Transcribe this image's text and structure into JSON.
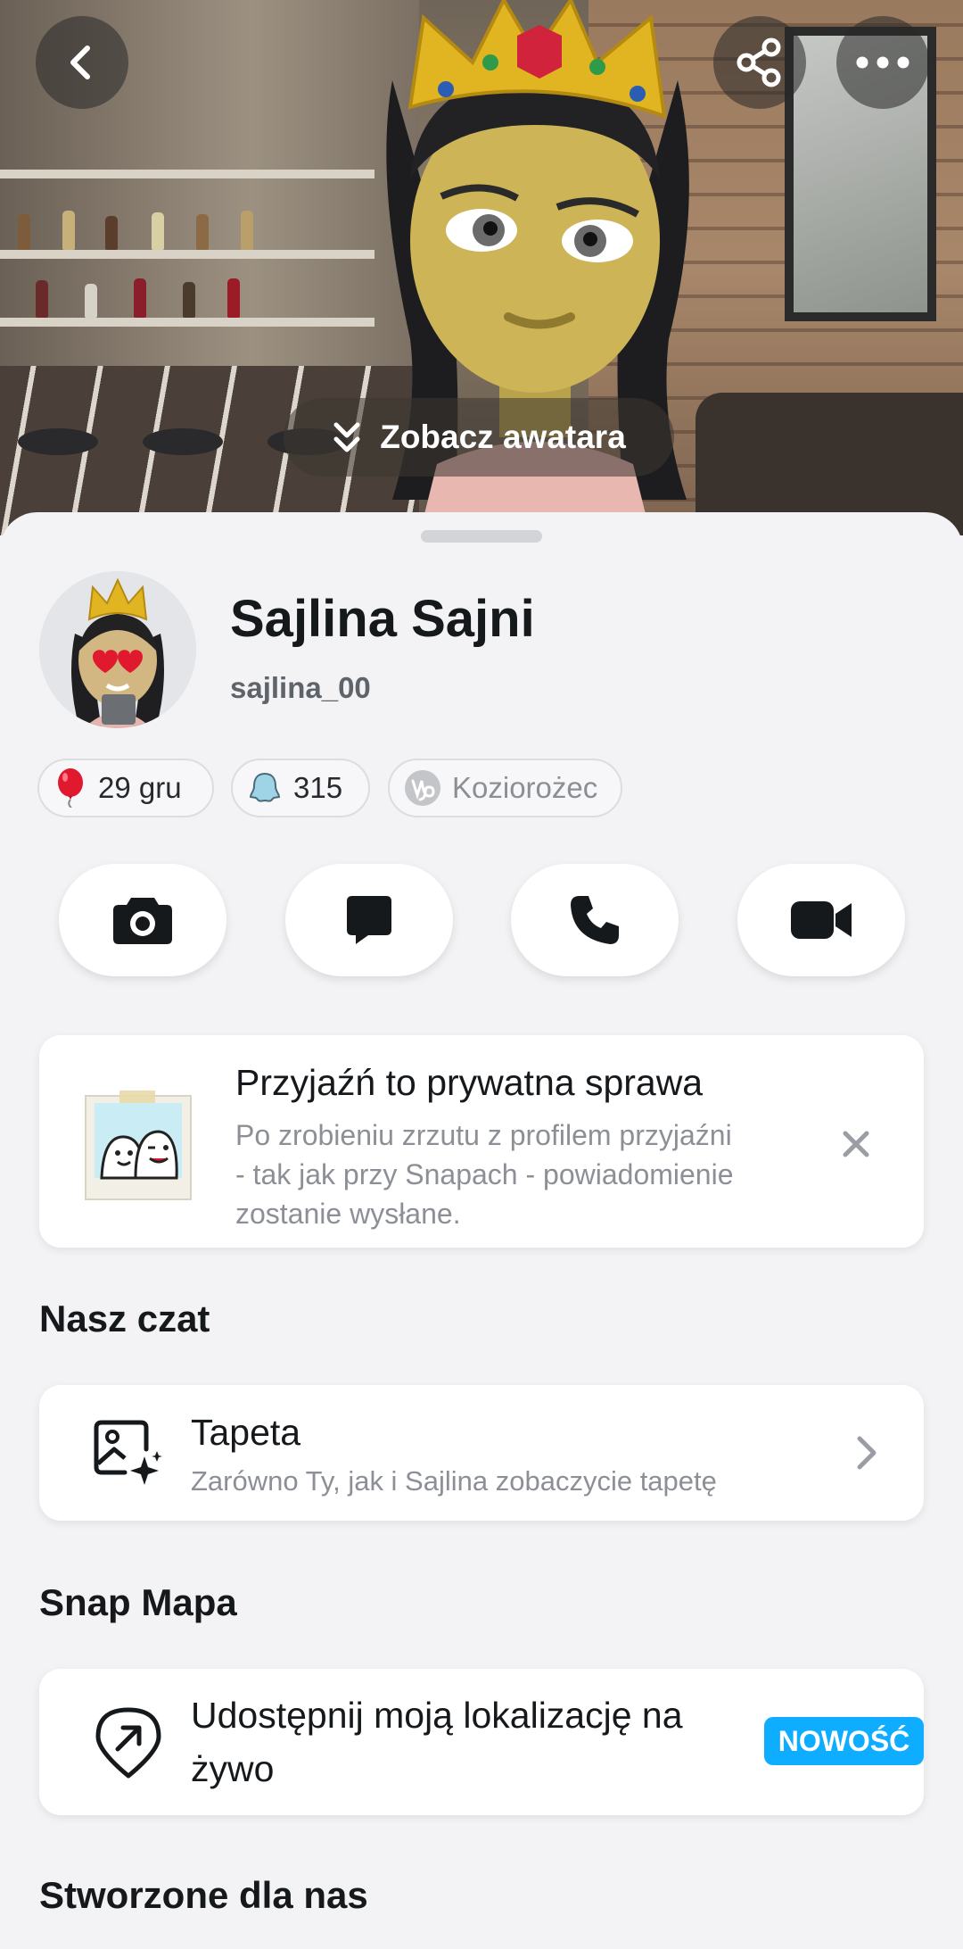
{
  "header": {
    "back_icon": "chevron-left-icon",
    "share_icon": "share-icon",
    "more_icon": "more-horizontal-icon",
    "see_avatar_label": "Zobacz awatara"
  },
  "profile": {
    "display_name": "Sajlina Sajni",
    "username": "sajlina_00",
    "chips": {
      "birthday": "29 gru",
      "snap_score": "315",
      "zodiac": "Koziorożec"
    }
  },
  "actions": [
    {
      "name": "camera",
      "icon": "camera-icon"
    },
    {
      "name": "chat",
      "icon": "chat-icon"
    },
    {
      "name": "call",
      "icon": "phone-icon"
    },
    {
      "name": "video-call",
      "icon": "video-icon"
    }
  ],
  "privacy_notice": {
    "title": "Przyjaźń to prywatna sprawa",
    "body": "Po zrobieniu zrzutu z profilem przyjaźni - tak jak przy Snapach - powiadomienie zostanie wysłane."
  },
  "our_chat": {
    "section_title": "Nasz czat",
    "wallpaper_title": "Tapeta",
    "wallpaper_subtitle": "Zarówno Ty, jak i Sajlina zobaczycie tapetę"
  },
  "snap_map": {
    "section_title": "Snap Mapa",
    "share_location_title": "Udostępnij moją lokalizację na żywo",
    "badge": "NOWOŚĆ"
  },
  "made_for_us": {
    "section_title": "Stworzone dla nas"
  },
  "colors": {
    "accent_badge": "#0fadff",
    "background": "#f3f3f5",
    "text_primary": "#16191c",
    "text_secondary": "#8c9096"
  }
}
